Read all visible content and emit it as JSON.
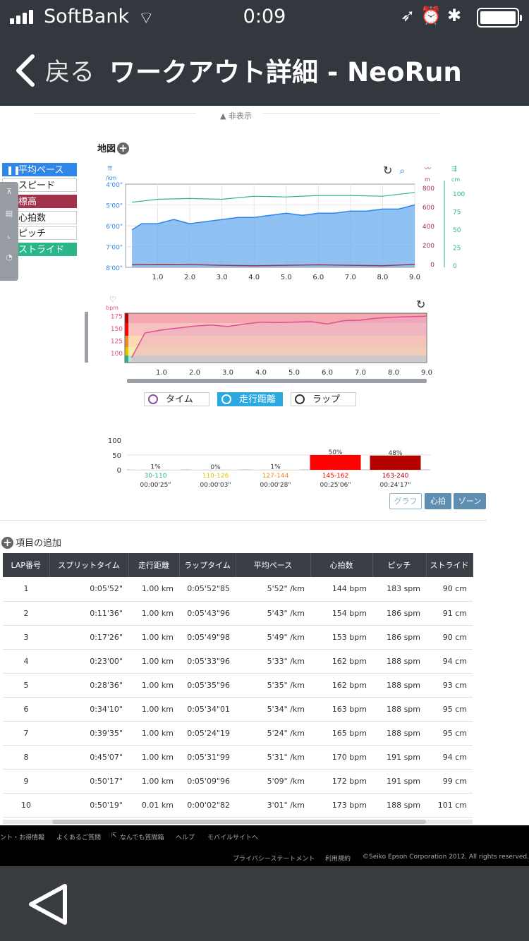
{
  "status_bar": {
    "carrier": "SoftBank",
    "time": "0:09"
  },
  "nav": {
    "back_label": "戻る",
    "title": "ワークアウト詳細 - NeoRun"
  },
  "hide_toggle": "▲ 非表示",
  "map_label": "地図",
  "legend": [
    "平均ペース",
    "スピード",
    "標高",
    "心拍数",
    "ピッチ",
    "ストライド"
  ],
  "colors": {
    "pace": "#2e86e8",
    "elevation": "#a2324a",
    "stride": "#2bb58a",
    "heart": "#e0508f",
    "zone5": "#b50000",
    "zone4": "#ff0000"
  },
  "chart1": {
    "left_unit": "/km",
    "left_ticks": [
      "4'00\"",
      "5'00\"",
      "6'00\"",
      "7'00\"",
      "8'00\""
    ],
    "mid_unit": "m",
    "mid_ticks": [
      "800",
      "600",
      "400",
      "200",
      "0"
    ],
    "right_unit": "cm",
    "right_ticks": [
      "100",
      "75",
      "50",
      "25",
      "0"
    ],
    "x_ticks": [
      "1.0",
      "2.0",
      "3.0",
      "4.0",
      "5.0",
      "6.0",
      "7.0",
      "8.0",
      "9.0"
    ]
  },
  "chart2": {
    "unit": "bpm",
    "y_ticks": [
      "175",
      "150",
      "125",
      "100"
    ],
    "x_ticks": [
      "1.0",
      "2.0",
      "3.0",
      "4.0",
      "5.0",
      "6.0",
      "7.0",
      "8.0",
      "9.0"
    ]
  },
  "toggles": {
    "time": "タイム",
    "distance": "走行距離",
    "lap": "ラップ"
  },
  "chart_data": [
    {
      "type": "line",
      "x_range": [
        0,
        9.0
      ],
      "series": [
        {
          "name": "平均ペース",
          "axis": "pace (min/km)",
          "x": [
            0.2,
            0.5,
            1.0,
            1.5,
            2.0,
            2.5,
            3.0,
            3.5,
            4.0,
            4.5,
            5.0,
            5.5,
            6.0,
            6.5,
            7.0,
            7.5,
            8.0,
            8.5,
            9.0
          ],
          "y": [
            6.2,
            5.9,
            5.9,
            5.7,
            5.9,
            5.8,
            5.7,
            5.6,
            5.6,
            5.5,
            5.4,
            5.5,
            5.4,
            5.4,
            5.3,
            5.3,
            5.2,
            5.2,
            5.0
          ]
        },
        {
          "name": "ストライド",
          "axis": "cm",
          "x": [
            0.2,
            1.0,
            2.0,
            3.0,
            4.0,
            5.0,
            6.0,
            7.0,
            8.0,
            9.0
          ],
          "y": [
            86,
            90,
            91,
            90,
            94,
            93,
            95,
            95,
            94,
            99
          ]
        },
        {
          "name": "標高",
          "axis": "m",
          "x": [
            0.2,
            1.0,
            2.0,
            3.0,
            4.0,
            5.0,
            6.0,
            7.0,
            8.0,
            9.0
          ],
          "y": [
            25,
            30,
            28,
            20,
            15,
            20,
            25,
            20,
            15,
            30
          ]
        }
      ]
    },
    {
      "type": "area",
      "x_range": [
        0,
        9.0
      ],
      "series": [
        {
          "name": "心拍数",
          "x": [
            0.1,
            0.5,
            1.0,
            1.5,
            2.0,
            2.5,
            3.0,
            3.5,
            4.0,
            4.5,
            5.0,
            5.5,
            6.0,
            6.5,
            7.0,
            7.5,
            8.0,
            8.5,
            9.0
          ],
          "y": [
            90,
            140,
            146,
            150,
            154,
            156,
            153,
            158,
            162,
            161,
            162,
            163,
            158,
            165,
            166,
            170,
            172,
            173,
            174
          ]
        }
      ]
    },
    {
      "type": "bar",
      "y_ticks": [
        "100",
        "50",
        "0"
      ],
      "ylim": [
        0,
        100
      ],
      "categories": [
        "30-110",
        "110-126",
        "127-144",
        "145-162",
        "163-240"
      ],
      "values": [
        1,
        0,
        1,
        50,
        48
      ],
      "value_labels": [
        "1%",
        "0%",
        "1%",
        "50%",
        "48%"
      ],
      "durations": [
        "00:00'25\"",
        "00:00'03\"",
        "00:00'28\"",
        "00:25'06\"",
        "00:24'17\""
      ],
      "category_colors": [
        "#2bb58a",
        "#e6c200",
        "#f08a2a",
        "#ff0000",
        "#b50000"
      ]
    }
  ],
  "view_buttons": {
    "graph": "グラフ",
    "heart": "心拍",
    "zone": "ゾーン"
  },
  "add_items": "項目の追加",
  "table": {
    "headers": [
      "LAP番号",
      "スプリットタイム",
      "走行距離",
      "ラップタイム",
      "平均ペース",
      "心拍数",
      "ピッチ",
      "ストライド"
    ],
    "rows": [
      [
        "1",
        "0:05'52\"",
        "1.00 km",
        "0:05'52\"85",
        "5'52\" /km",
        "144 bpm",
        "183 spm",
        "90 cm"
      ],
      [
        "2",
        "0:11'36\"",
        "1.00 km",
        "0:05'43\"96",
        "5'43\" /km",
        "154 bpm",
        "186 spm",
        "91 cm"
      ],
      [
        "3",
        "0:17'26\"",
        "1.00 km",
        "0:05'49\"98",
        "5'49\" /km",
        "153 bpm",
        "186 spm",
        "90 cm"
      ],
      [
        "4",
        "0:23'00\"",
        "1.00 km",
        "0:05'33\"96",
        "5'33\" /km",
        "162 bpm",
        "188 spm",
        "94 cm"
      ],
      [
        "5",
        "0:28'36\"",
        "1.00 km",
        "0:05'35\"96",
        "5'35\" /km",
        "162 bpm",
        "188 spm",
        "93 cm"
      ],
      [
        "6",
        "0:34'10\"",
        "1.00 km",
        "0:05'34\"01",
        "5'34\" /km",
        "163 bpm",
        "188 spm",
        "95 cm"
      ],
      [
        "7",
        "0:39'35\"",
        "1.00 km",
        "0:05'24\"19",
        "5'24\" /km",
        "165 bpm",
        "188 spm",
        "95 cm"
      ],
      [
        "8",
        "0:45'07\"",
        "1.00 km",
        "0:05'31\"99",
        "5'31\" /km",
        "170 bpm",
        "191 spm",
        "94 cm"
      ],
      [
        "9",
        "0:50'17\"",
        "1.00 km",
        "0:05'09\"96",
        "5'09\" /km",
        "172 bpm",
        "191 spm",
        "99 cm"
      ],
      [
        "10",
        "0:50'19\"",
        "0.01 km",
        "0:00'02\"82",
        "3'01\" /km",
        "173 bpm",
        "188 spm",
        "101 cm"
      ]
    ]
  },
  "footer": {
    "links": [
      "ント・お得情報",
      "よくあるご質問",
      "なんでも質問箱",
      "ヘルプ",
      "モバイルサイトへ"
    ],
    "privacy": "プライバシーステートメント",
    "terms": "利用規約",
    "copyright": "©Seiko Epson Corporation 2012. All rights reserved."
  }
}
